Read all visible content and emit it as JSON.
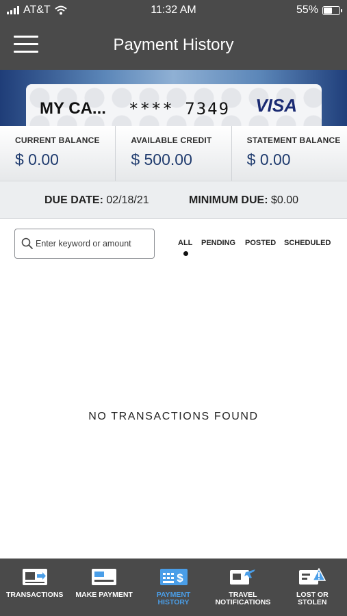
{
  "status_bar": {
    "carrier": "AT&T",
    "time": "11:32 AM",
    "battery": "55%",
    "battery_level": 0.55
  },
  "nav": {
    "title": "Payment History",
    "menu_icon": "hamburger-menu-icon"
  },
  "card": {
    "name": "MY CA...",
    "number": "**** 7349",
    "brand": "VISA"
  },
  "balances": [
    {
      "label": "CURRENT BALANCE",
      "value": "$ 0.00"
    },
    {
      "label": "AVAILABLE CREDIT",
      "value": "$ 500.00"
    },
    {
      "label": "STATEMENT BALANCE",
      "value": "$ 0.00"
    }
  ],
  "due": {
    "due_date_label": "DUE DATE:",
    "due_date_value": "02/18/21",
    "minimum_due_label": "MINIMUM DUE:",
    "minimum_due_value": "$0.00"
  },
  "search": {
    "placeholder": "Enter keyword or amount",
    "value": ""
  },
  "filters": {
    "items": [
      "ALL",
      "PENDING",
      "POSTED",
      "SCHEDULED"
    ],
    "selected": "ALL"
  },
  "empty_state": "NO TRANSACTIONS FOUND",
  "tabs": [
    {
      "label": "TRANSACTIONS",
      "icon": "transactions-icon",
      "active": false
    },
    {
      "label": "MAKE PAYMENT",
      "icon": "make-payment-icon",
      "active": false
    },
    {
      "label": "PAYMENT\nHISTORY",
      "icon": "payment-history-icon",
      "active": true
    },
    {
      "label": "TRAVEL\nNOTIFICATIONS",
      "icon": "travel-notifications-icon",
      "active": false
    },
    {
      "label": "LOST OR\nSTOLEN",
      "icon": "lost-or-stolen-icon",
      "active": false
    }
  ],
  "colors": {
    "header_bg": "#4a4a4a",
    "balance_value": "#1f3b6e",
    "active_tab": "#4a9ee8",
    "visa_blue": "#1a2a72"
  }
}
